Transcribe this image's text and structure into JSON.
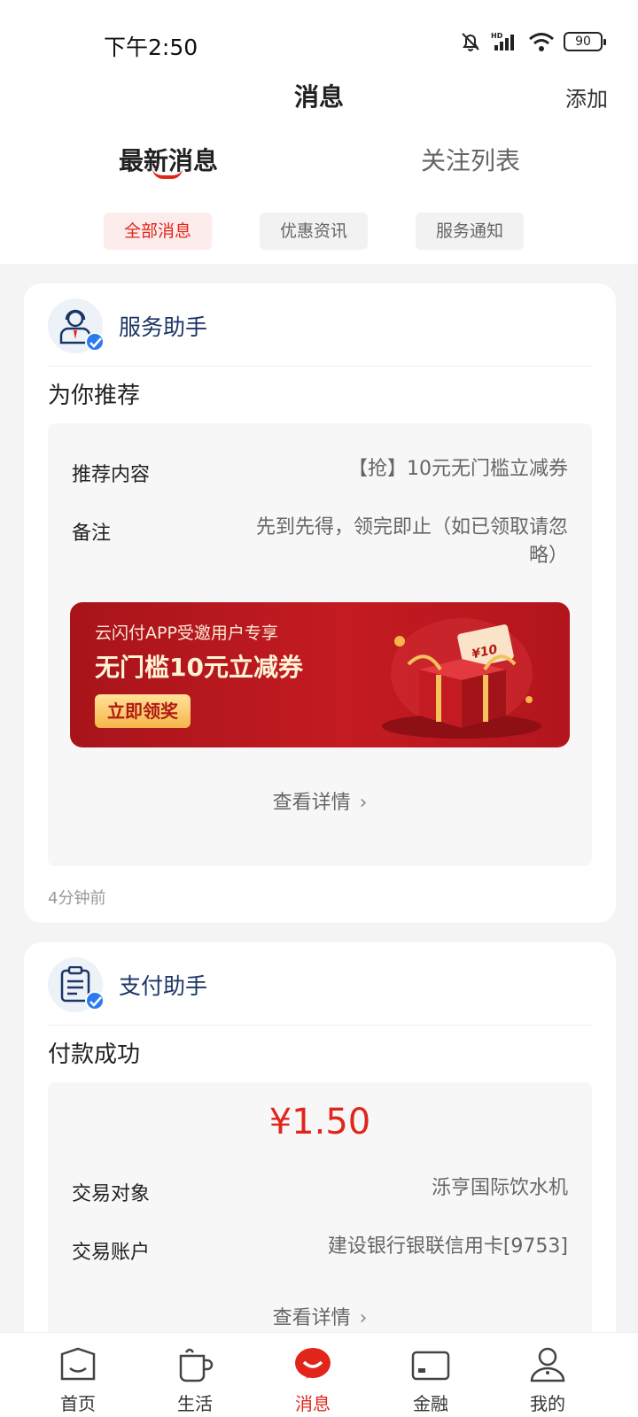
{
  "status_bar": {
    "time": "下午2:50",
    "battery": "90"
  },
  "header": {
    "title": "消息",
    "add_label": "添加"
  },
  "tabs": [
    {
      "label": "最新消息",
      "active": true
    },
    {
      "label": "关注列表",
      "active": false
    }
  ],
  "filters": [
    {
      "label": "全部消息",
      "active": true
    },
    {
      "label": "优惠资讯",
      "active": false
    },
    {
      "label": "服务通知",
      "active": false
    }
  ],
  "cards": [
    {
      "sender": "服务助手",
      "avatar_icon": "customer-service-icon",
      "subtitle": "为你推荐",
      "rows": [
        {
          "label": "推荐内容",
          "value": "【抢】10元无门槛立减券"
        },
        {
          "label": "备注",
          "value_line1": "先到先得，领完即止（如已领取请忽",
          "value_line2": "略）"
        }
      ],
      "banner": {
        "line1": "云闪付APP受邀用户专享",
        "line2": "无门槛10元立减券",
        "button": "立即领奖",
        "coupon_text": "¥10"
      },
      "detail_link": "查看详情",
      "time": "4分钟前"
    },
    {
      "sender": "支付助手",
      "avatar_icon": "clipboard-icon",
      "subtitle": "付款成功",
      "amount": "¥1.50",
      "rows": [
        {
          "label": "交易对象",
          "value": "泺亨国际饮水机"
        },
        {
          "label": "交易账户",
          "value": "建设银行银联信用卡[9753]"
        }
      ],
      "detail_link": "查看详情"
    }
  ],
  "bottom_nav": [
    {
      "label": "首页",
      "icon": "home-icon",
      "active": false
    },
    {
      "label": "生活",
      "icon": "cup-icon",
      "active": false
    },
    {
      "label": "消息",
      "icon": "message-icon",
      "active": true
    },
    {
      "label": "金融",
      "icon": "card-icon",
      "active": false
    },
    {
      "label": "我的",
      "icon": "person-icon",
      "active": false
    }
  ],
  "colors": {
    "accent": "#e1251b",
    "sender": "#1b3566",
    "background": "#f4f4f5"
  }
}
